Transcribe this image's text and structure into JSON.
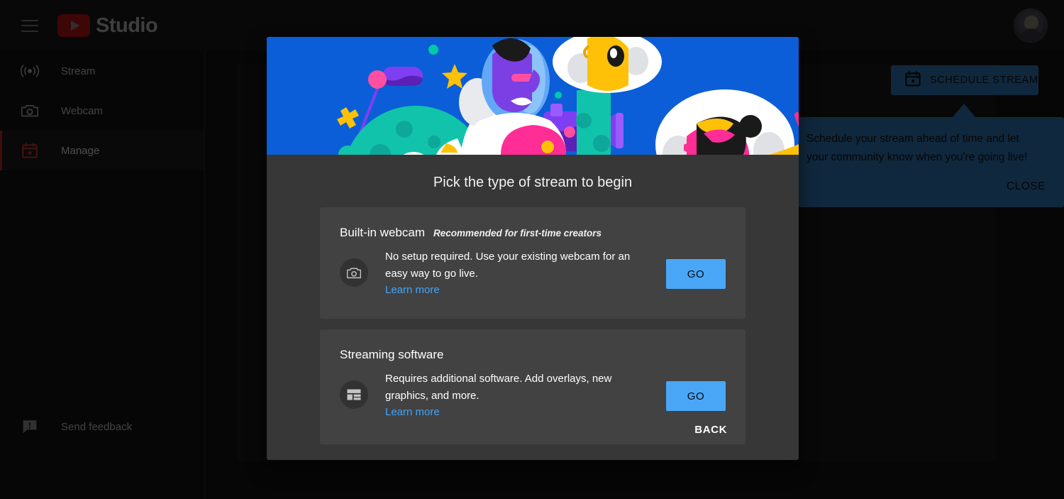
{
  "topbar": {
    "menu_icon": "hamburger-icon",
    "brand_word": "Studio",
    "logo_icon": "youtube-play-icon",
    "avatar_icon": "user-avatar"
  },
  "sidebar": {
    "items": [
      {
        "label": "Stream",
        "icon": "broadcast-icon",
        "active": false
      },
      {
        "label": "Webcam",
        "icon": "camera-icon",
        "active": false
      },
      {
        "label": "Manage",
        "icon": "calendar-icon",
        "active": true
      }
    ],
    "feedback": {
      "label": "Send feedback",
      "icon": "feedback-icon"
    }
  },
  "schedule_button": {
    "label": "SCHEDULE STREAM",
    "icon": "calendar-icon"
  },
  "tooltip": {
    "text": "Schedule your stream ahead of time and let your community know when you're going live!",
    "close_label": "CLOSE"
  },
  "dialog": {
    "title": "Pick the type of stream to begin",
    "hero_icon": "space-creators-illustration",
    "cards": [
      {
        "title": "Built-in webcam",
        "subtitle": "Recommended for first-time creators",
        "description": "No setup required. Use your existing webcam for an easy way to go live.",
        "link_label": "Learn more",
        "button_label": "GO",
        "icon": "camera-icon"
      },
      {
        "title": "Streaming software",
        "subtitle": "",
        "description": "Requires additional software. Add overlays, new graphics, and more.",
        "link_label": "Learn more",
        "button_label": "GO",
        "icon": "layout-dashboard-icon"
      }
    ],
    "back_label": "BACK"
  },
  "colors": {
    "brand_red": "#8b1212",
    "accent_blue": "#4aa6f7",
    "link_blue": "#3ea6ff",
    "tooltip_blue": "#265b8c",
    "hero_blue": "#0b5ed7",
    "dialog_bg": "#373737",
    "card_bg": "#424242",
    "page_bg": "#0f0f0f"
  }
}
